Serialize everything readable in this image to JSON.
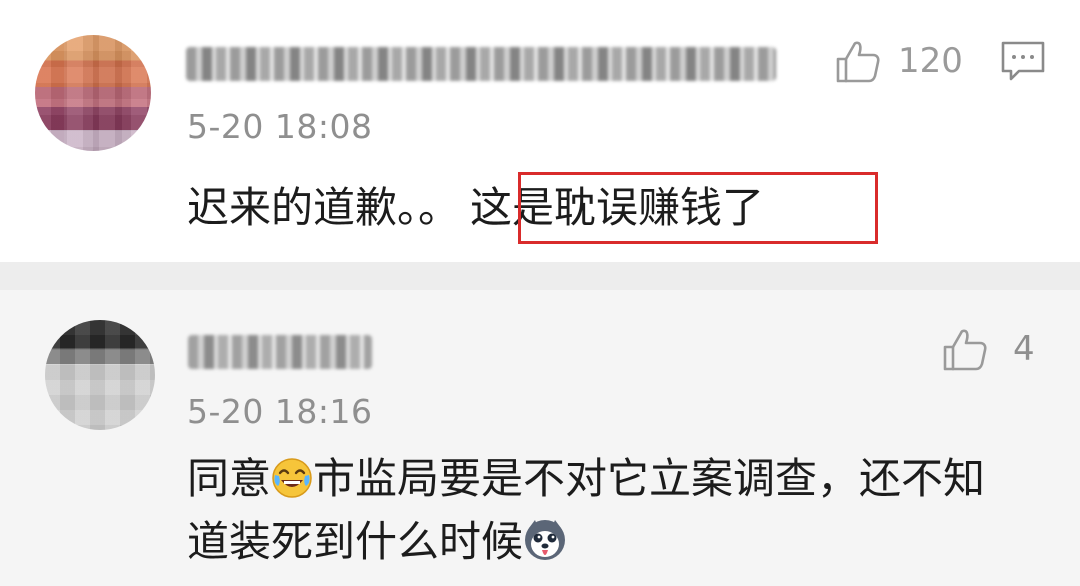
{
  "comments": [
    {
      "timestamp": "5-20 18:08",
      "likes": "120",
      "text_plain": "迟来的道歉。。",
      "text_highlighted": "这是耽误赚钱了"
    },
    {
      "timestamp": "5-20 18:16",
      "likes": "4",
      "line1_prefix": "同意",
      "line1_suffix": "市监局要是不对它立案调查，还不知",
      "line2_text": "道装死到什么时候",
      "emojis": [
        "laughing-tears-emoji",
        "husky-dog-emoji"
      ]
    }
  ],
  "icons": {
    "like": "thumbs-up-icon",
    "reply": "comment-reply-icon"
  },
  "colors": {
    "highlight_border": "#d92b2b",
    "meta_text": "#8f8f8f",
    "body_text": "#1c1c1c",
    "divider": "#ededed",
    "second_comment_bg": "#f5f5f5"
  }
}
